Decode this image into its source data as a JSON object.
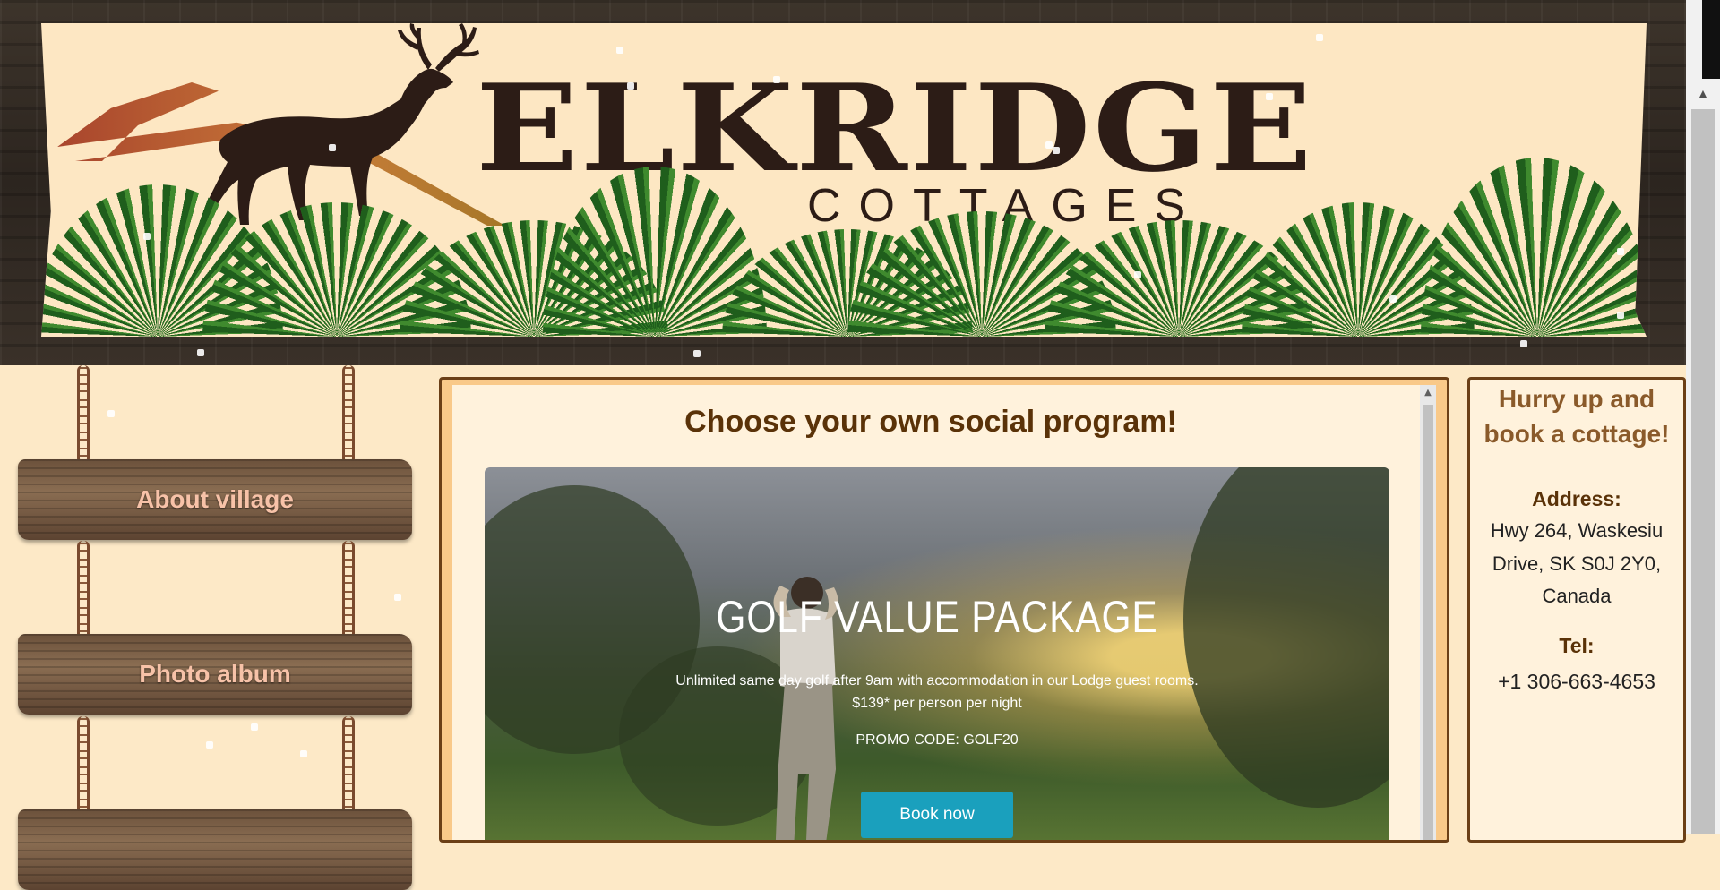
{
  "header": {
    "title_main": "ELKRIDGE",
    "title_sub": "COTTAGES",
    "logo_icon": "elk-icon",
    "decoration_icon": "pine-branch-icon"
  },
  "nav": {
    "items": [
      {
        "label": "About village"
      },
      {
        "label": "Photo album"
      },
      {
        "label": ""
      }
    ]
  },
  "main": {
    "title": "Choose your own social program!",
    "promo": {
      "title": "GOLF VALUE PACKAGE",
      "line1": "Unlimited same day golf after 9am with accommodation in our Lodge guest rooms.",
      "line2": "$139* per person per night",
      "promo_code": "PROMO CODE: GOLF20",
      "button_label": "Book now"
    }
  },
  "sidebar": {
    "cta": "Hurry up and book a cottage!",
    "address_label": "Address:",
    "address_value": "Hwy 264, Waskesiu Drive, SK S0J 2Y0, Canada",
    "tel_label": "Tel:",
    "tel_value": "+1 306-663-4653"
  },
  "colors": {
    "page_background": "#fde9c7",
    "heading": "#5a3208",
    "accent_button": "#1aa0bd",
    "nav_text": "#f7c2a8"
  }
}
